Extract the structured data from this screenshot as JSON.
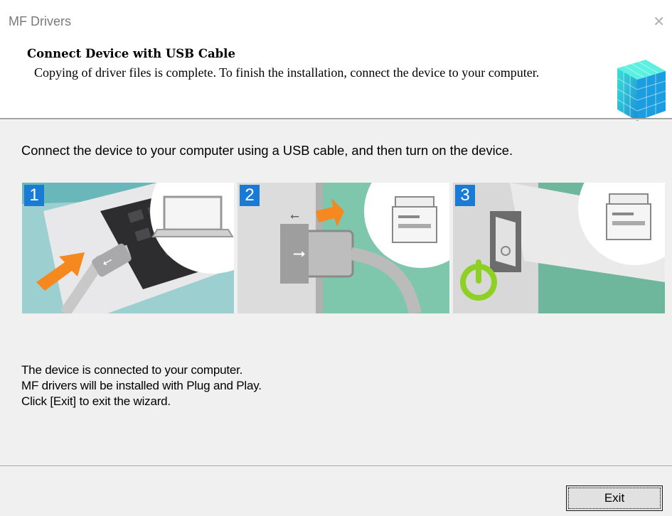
{
  "window": {
    "title": "MF Drivers"
  },
  "header": {
    "title": "Connect Device with USB Cable",
    "subtitle": "Copying of driver files is complete. To finish the installation, connect the device to your computer."
  },
  "main": {
    "instruction": "Connect the device to your computer using a USB cable, and then turn on the device.",
    "steps": [
      {
        "number": "1",
        "illustration": "laptop-usb-port"
      },
      {
        "number": "2",
        "illustration": "printer-usb-port"
      },
      {
        "number": "3",
        "illustration": "printer-power-switch"
      }
    ],
    "messages": [
      "The device is connected to your computer.",
      "MF drivers will be installed with Plug and Play.",
      "Click [Exit] to exit the wizard."
    ]
  },
  "footer": {
    "exit_label": "Exit"
  },
  "colors": {
    "step_badge": "#1a7bd6",
    "arrow": "#f5891f",
    "power_glow": "#8fd024"
  }
}
